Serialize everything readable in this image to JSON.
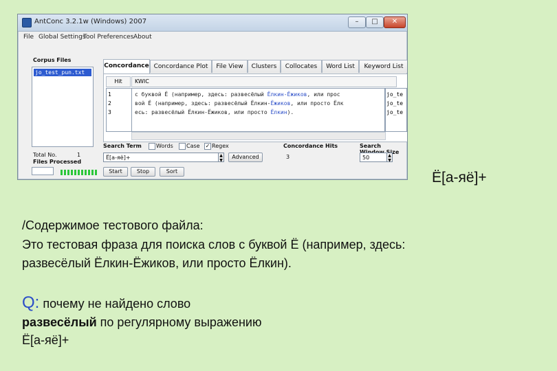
{
  "window": {
    "title": "AntConc 3.2.1w (Windows) 2007",
    "buttons": {
      "minimize": "–",
      "maximize": "□",
      "close": "✕"
    }
  },
  "menu": [
    "File",
    "Global Settings",
    "Tool Preferences",
    "About"
  ],
  "corpus": {
    "label": "Corpus Files",
    "files": [
      "jo_test_pun.txt"
    ],
    "total_label": "Total No.",
    "total_value": "1",
    "processed_label": "Files Processed"
  },
  "tabs": [
    "Concordance",
    "Concordance Plot",
    "File View",
    "Clusters",
    "Collocates",
    "Word List",
    "Keyword List"
  ],
  "kwic": {
    "hit_header": "Hit",
    "kwic_header": "KWIC",
    "hits": [
      "1",
      "2",
      "3"
    ],
    "lines": [
      {
        "pre": "с буквой Ё (например, здесь: развесёлый ",
        "key": "Ёлкин-Ёжиков",
        "post": ", или прос"
      },
      {
        "pre": "вой Ё (например, здесь: развесёлый Ёлкин-",
        "key": "Ёжиков",
        "post": ", или просто Ёлк"
      },
      {
        "pre": "есь: развесёлый Ёлкин-Ёжиков, или просто ",
        "key": "Ёлкин",
        "post": ")."
      }
    ],
    "right_col": [
      "jo_te",
      "jo_te",
      "jo_te"
    ]
  },
  "search": {
    "label": "Search Term",
    "words_label": "Words",
    "case_label": "Case",
    "regex_label": "Regex",
    "regex_checked": "✓",
    "value": "Ё[а-яё]+",
    "advanced_label": "Advanced",
    "start_label": "Start",
    "stop_label": "Stop",
    "sort_label": "Sort"
  },
  "hits_info": {
    "label": "Concordance Hits",
    "value": "3"
  },
  "search_window": {
    "label": "Search Window Size",
    "value": "50"
  },
  "slide": {
    "regex_display": "Ё[а-яё]+",
    "content_heading": "/Содержимое тестового файла:",
    "content_line1": "Это тестовая фраза для поиска слов с буквой Ё (например, здесь:",
    "content_line2": "развесёлый Ёлкин-Ёжиков, или просто Ёлкин).",
    "question_q": "Q:",
    "question_text": " почему не найдено слово",
    "question_word": "развесёлый",
    "question_rest": " по регулярному выражению",
    "question_regex": "Ё[а-яё]+"
  }
}
